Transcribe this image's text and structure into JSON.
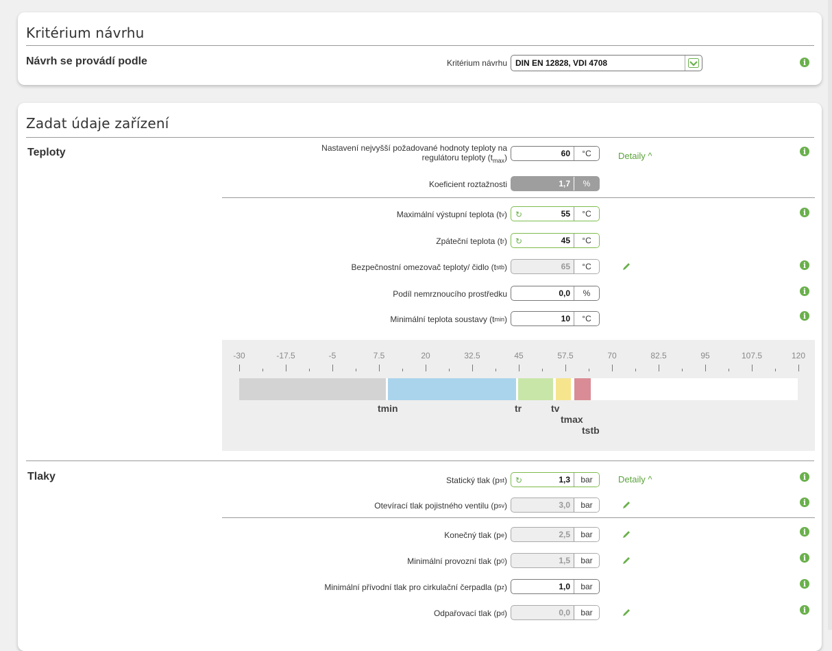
{
  "card1": {
    "title": "Kritérium návrhu",
    "section": "Návrh se provádí podle",
    "field_label": "Kritérium návrhu",
    "field_value": "DIN EN 12828, VDI 4708"
  },
  "card2": {
    "title": "Zadat údaje zařízení",
    "teploty": {
      "section": "Teploty",
      "details_label": "Detaily",
      "rows": {
        "tmax": {
          "label_a": "Nastavení nejvyšší požadované hodnoty teploty na",
          "label_b": "regulátoru teploty (t",
          "sub": "max",
          "label_end": ")",
          "value": "60",
          "unit": "°C"
        },
        "koef": {
          "label": "Koeficient roztažnosti",
          "value": "1,7",
          "unit": "%"
        },
        "tv": {
          "label": "Maximální výstupní teplota (t",
          "sub": "v",
          "label_end": ")",
          "value": "55",
          "unit": "°C"
        },
        "tr": {
          "label": "Zpáteční teplota (t",
          "sub": "r",
          "label_end": ")",
          "value": "45",
          "unit": "°C"
        },
        "tstb": {
          "label": "Bezpečnostní omezovač teploty/ čidlo (t",
          "sub": "stb",
          "label_end": ")",
          "value": "65",
          "unit": "°C"
        },
        "antifreeze": {
          "label": "Podíl nemrznoucího prostředku",
          "value": "0,0",
          "unit": "%"
        },
        "tmin": {
          "label": "Minimální teplota soustavy (t",
          "sub": "min",
          "label_end": ")",
          "value": "10",
          "unit": "°C"
        }
      },
      "scale": {
        "ticks": [
          "-30",
          "-17.5",
          "-5",
          "7.5",
          "20",
          "32.5",
          "45",
          "57.5",
          "70",
          "82.5",
          "95",
          "107.5",
          "120"
        ],
        "markers": {
          "tmin": "tmin",
          "tr": "tr",
          "tv": "tv",
          "tmax": "tmax",
          "tstb": "tstb"
        }
      }
    },
    "tlaky": {
      "section": "Tlaky",
      "details_label": "Detaily",
      "rows": {
        "pst": {
          "label": "Statický tlak (p",
          "sub": "st",
          "label_end": ")",
          "value": "1,3",
          "unit": "bar"
        },
        "psv": {
          "label": "Otevírací tlak pojistného ventilu (p",
          "sub": "sv",
          "label_end": ")",
          "value": "3,0",
          "unit": "bar"
        },
        "pe": {
          "label": "Konečný tlak (p",
          "sub": "e",
          "label_end": ")",
          "value": "2,5",
          "unit": "bar"
        },
        "p0": {
          "label": "Minimální provozní tlak (p",
          "sub": "0",
          "label_end": ")",
          "value": "1,5",
          "unit": "bar"
        },
        "pz": {
          "label": "Minimální přívodní tlak pro cirkulační čerpadla (p",
          "sub": "z",
          "label_end": ")",
          "value": "1,0",
          "unit": "bar"
        },
        "pd": {
          "label": "Odpařovací tlak (p",
          "sub": "d",
          "label_end": ")",
          "value": "0,0",
          "unit": "bar"
        }
      }
    }
  },
  "colors": {
    "accent": "#6ab04c",
    "cold": "#d3d3d3",
    "blue": "#a9d4ec",
    "green": "#c8e6a8",
    "yellow": "#f6e58d",
    "red": "#d98c95"
  }
}
